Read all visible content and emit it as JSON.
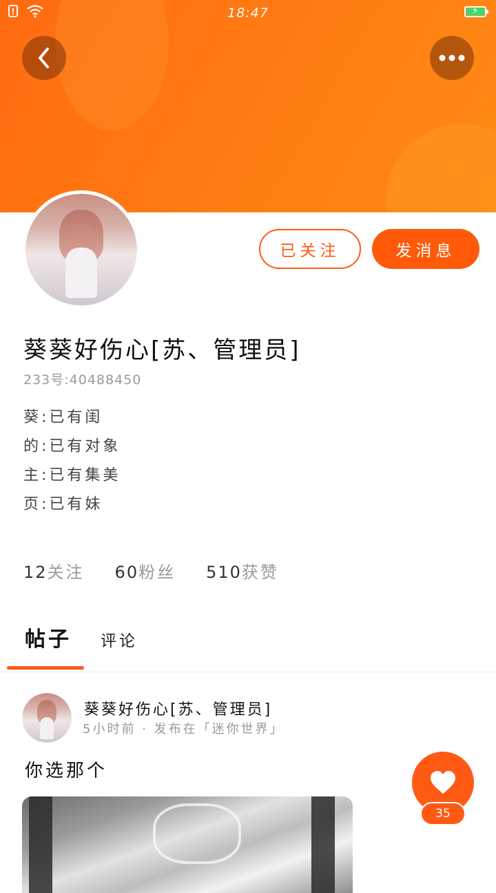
{
  "status_bar": {
    "time": "18:47",
    "icons": [
      "sim-alert-icon",
      "wifi-icon",
      "battery-charging-icon"
    ]
  },
  "nav": {
    "back_icon": "chevron-left-icon",
    "more_icon": "more-horizontal-icon"
  },
  "profile": {
    "follow_label": "已关注",
    "message_label": "发消息",
    "username": "葵葵好伤心[苏、管理员]",
    "uid": "233号:40488450",
    "bio": [
      "葵:已有闺",
      "的:已有对象",
      "主:已有集美",
      "页:已有妹"
    ],
    "stats": [
      {
        "num": "12",
        "label": "关注"
      },
      {
        "num": "60",
        "label": "粉丝"
      },
      {
        "num": "510",
        "label": "获赞"
      }
    ]
  },
  "tabs": {
    "posts": "帖子",
    "comments": "评论",
    "active": "posts"
  },
  "post": {
    "author": "葵葵好伤心[苏、管理员]",
    "meta": "5小时前 · 发布在「迷你世界」",
    "text": "你选那个",
    "like_count": "35"
  },
  "colors": {
    "accent": "#ff5a14",
    "header_gradient_start": "#ff6a10",
    "header_gradient_end": "#ff8a14"
  }
}
